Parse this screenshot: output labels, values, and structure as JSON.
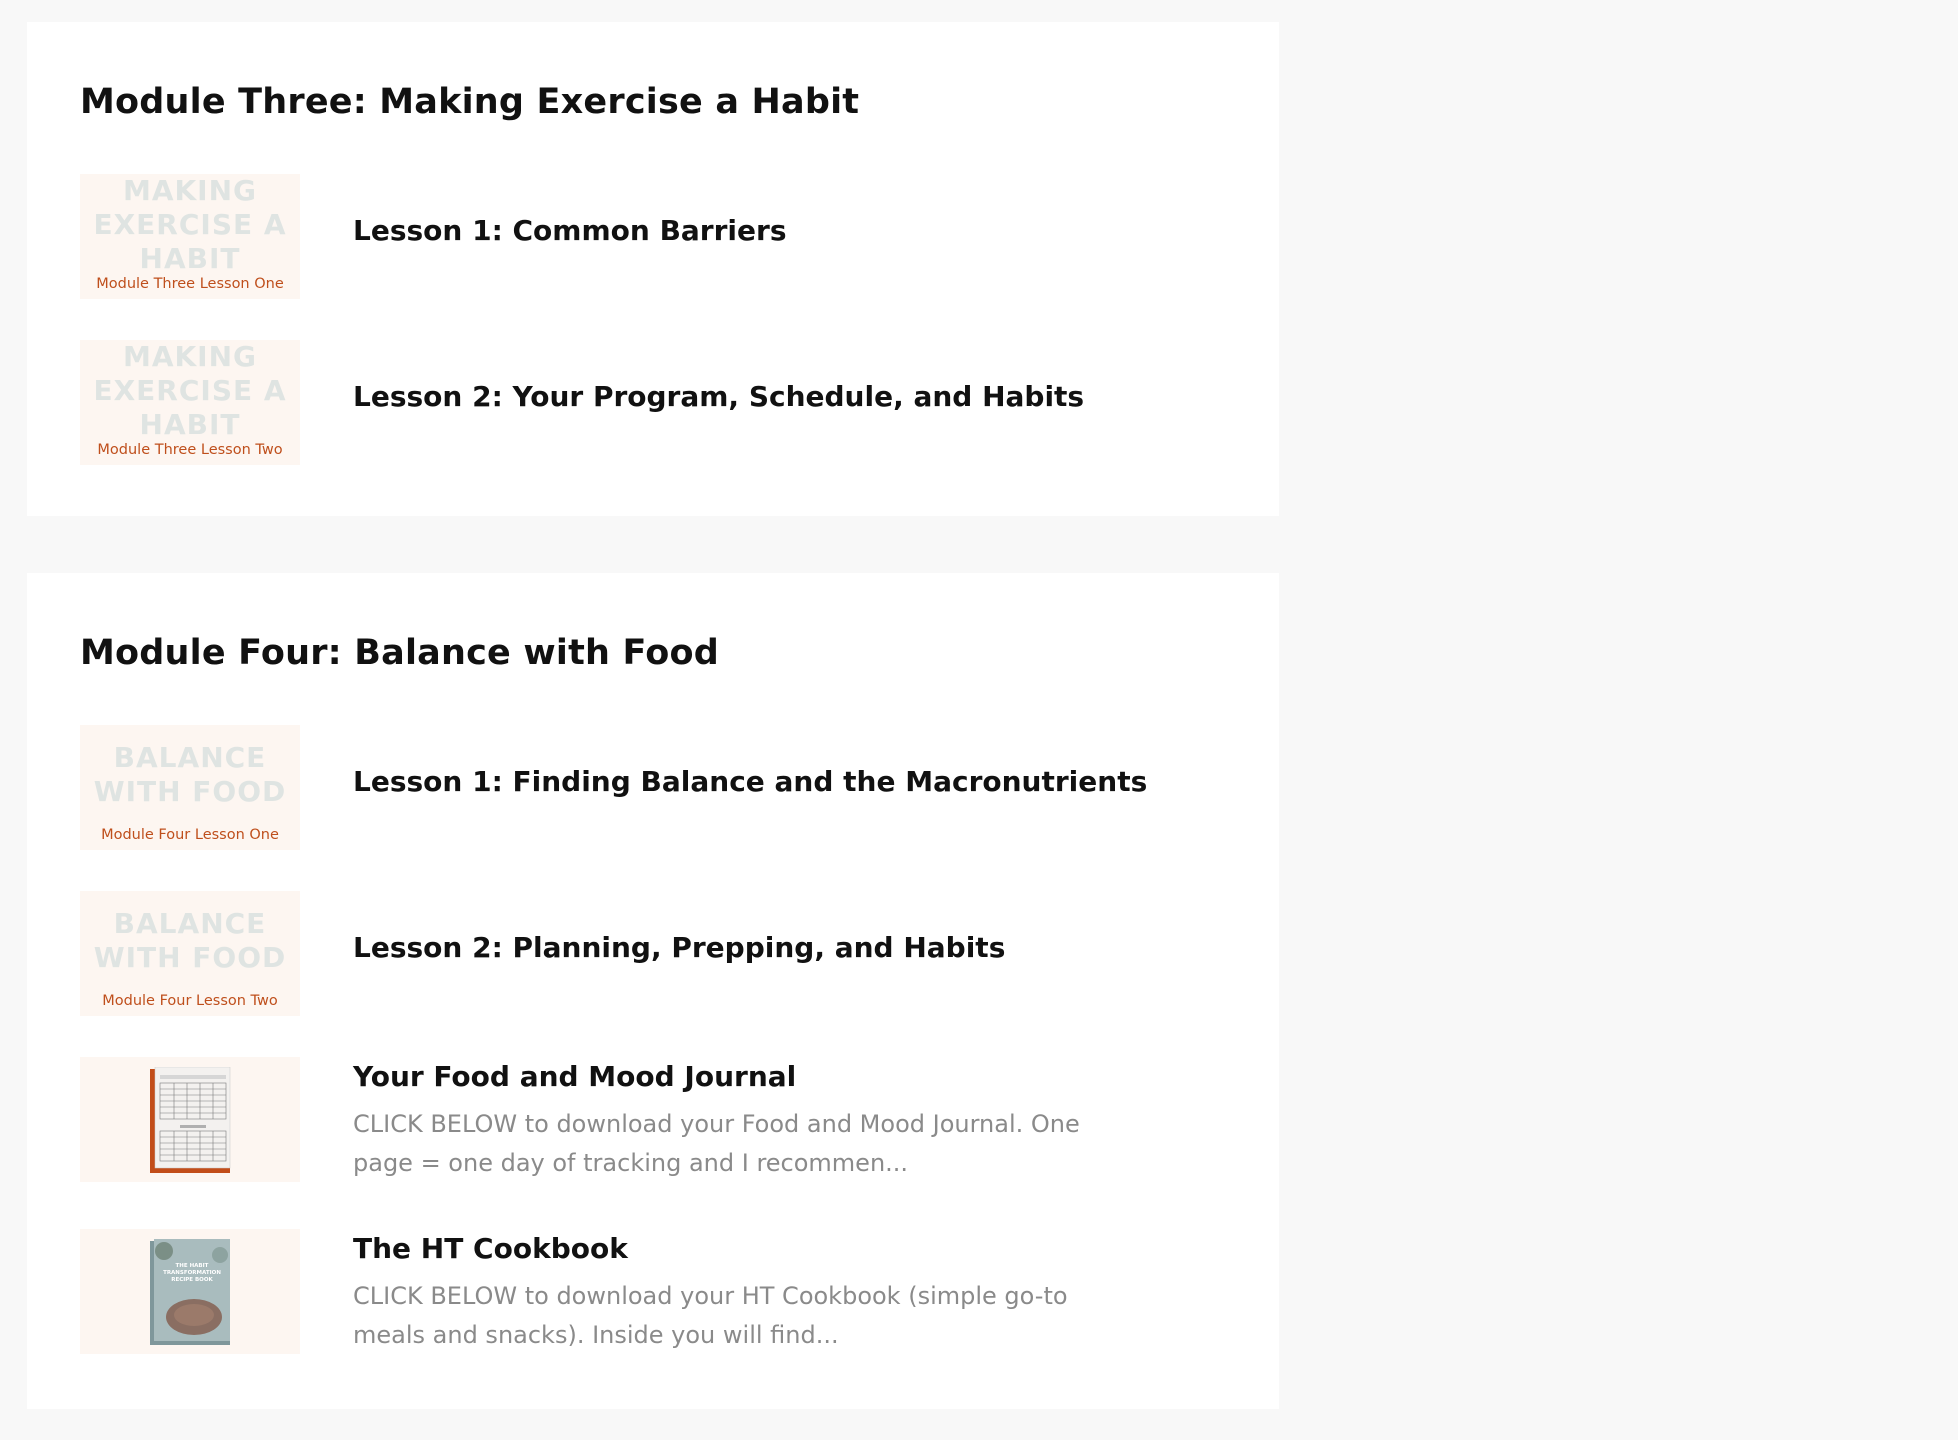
{
  "colors": {
    "page_background": "#f8f8f8",
    "card_background": "#ffffff",
    "thumbnail_background": "#fdf6f1",
    "thumbnail_accent": "#bf4f1c",
    "thumbnail_watermark": "#dfe4e2",
    "description_text": "#8a8a8a"
  },
  "modules": [
    {
      "title": "Module Three: Making Exercise a Habit",
      "lessons": [
        {
          "title": "Lesson 1: Common Barriers",
          "thumb_lines": [
            "MAKING",
            "EXERCISE A",
            "HABIT"
          ],
          "thumb_caption": "Module Three Lesson One"
        },
        {
          "title": "Lesson 2: Your Program, Schedule, and Habits",
          "thumb_lines": [
            "MAKING",
            "EXERCISE A",
            "HABIT"
          ],
          "thumb_caption": "Module Three Lesson Two"
        }
      ]
    },
    {
      "title": "Module Four: Balance with Food",
      "lessons": [
        {
          "title": "Lesson 1: Finding Balance and the Macronutrients",
          "thumb_lines": [
            "BALANCE",
            "WITH FOOD"
          ],
          "thumb_caption": "Module Four Lesson One"
        },
        {
          "title": "Lesson 2: Planning, Prepping, and Habits",
          "thumb_lines": [
            "BALANCE",
            "WITH FOOD"
          ],
          "thumb_caption": "Module Four Lesson Two"
        },
        {
          "title": "Your Food and Mood Journal",
          "description": "CLICK BELOW to download your Food and Mood Journal. One page = one day of tracking and I recommen...",
          "thumb_icon": "journal-book-icon"
        },
        {
          "title": "The HT Cookbook",
          "description": "CLICK BELOW  to download your HT Cookbook (simple go-to meals and snacks).   Inside you will find...",
          "thumb_icon": "cookbook-icon",
          "thumb_cover_text": [
            "THE HABIT",
            "TRANSFORMATION",
            "RECIPE BOOK"
          ]
        }
      ]
    }
  ]
}
